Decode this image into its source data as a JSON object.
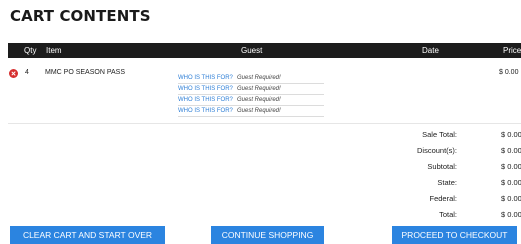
{
  "page": {
    "title": "CART CONTENTS"
  },
  "table": {
    "headers": {
      "qty": "Qty",
      "item": "Item",
      "guest": "Guest",
      "date": "Date",
      "price": "Price"
    },
    "rows": [
      {
        "remove_icon": "remove-circle-icon",
        "qty": "4",
        "item": "MMC PO SEASON PASS",
        "price": "$ 0.00",
        "guests": [
          {
            "link": "WHO IS THIS FOR?",
            "status": "Guest Required!"
          },
          {
            "link": "WHO IS THIS FOR?",
            "status": "Guest Required!"
          },
          {
            "link": "WHO IS THIS FOR?",
            "status": "Guest Required!"
          },
          {
            "link": "WHO IS THIS FOR?",
            "status": "Guest Required!"
          }
        ]
      }
    ]
  },
  "totals": [
    {
      "label": "Sale Total:",
      "value": "$ 0.00"
    },
    {
      "label": "Discount(s):",
      "value": "$ 0.00"
    },
    {
      "label": "Subtotal:",
      "value": "$ 0.00"
    },
    {
      "label": "State:",
      "value": "$ 0.00"
    },
    {
      "label": "Federal:",
      "value": "$ 0.00"
    },
    {
      "label": "Total:",
      "value": "$ 0.00"
    }
  ],
  "buttons": {
    "clear": "CLEAR CART AND START OVER",
    "continue": "CONTINUE SHOPPING",
    "checkout": "PROCEED TO CHECKOUT"
  },
  "colors": {
    "header_bg": "#1c1c1c",
    "button_bg": "#2b84e0",
    "link": "#2f7fd6",
    "remove": "#d62f2f"
  }
}
